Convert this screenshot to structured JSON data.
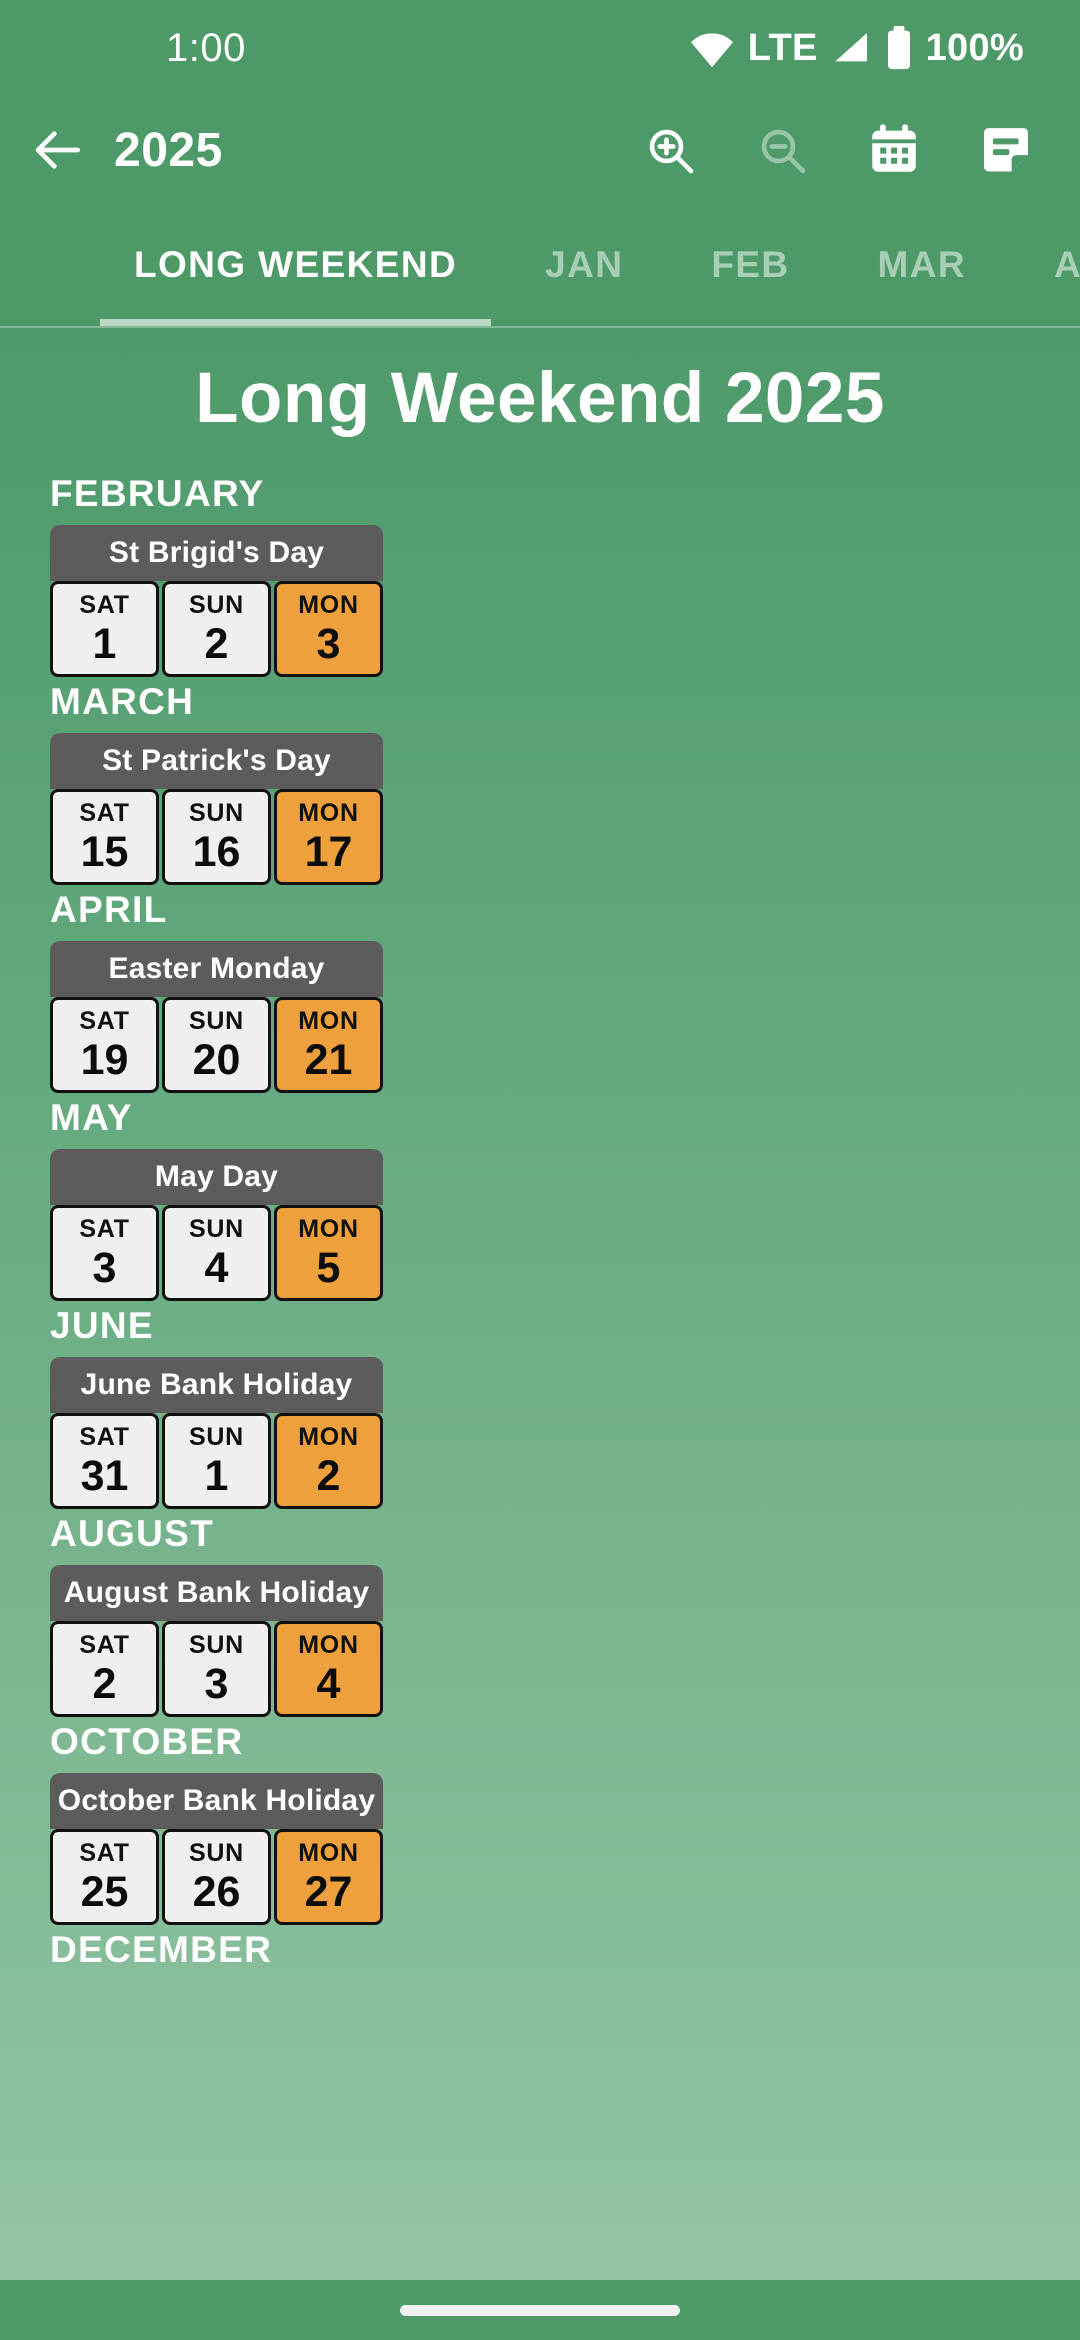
{
  "status_bar": {
    "clock": "1:00",
    "network_label": "LTE",
    "battery_label": "100%",
    "wifi_icon": "wifi-icon",
    "signal_icon": "signal-icon",
    "battery_icon": "battery-icon"
  },
  "app_bar": {
    "back_icon": "back-arrow-icon",
    "title": "2025",
    "actions": [
      {
        "icon": "zoom-in-icon",
        "label": "Zoom in",
        "disabled": false
      },
      {
        "icon": "zoom-out-icon",
        "label": "Zoom out",
        "disabled": true
      },
      {
        "icon": "calendar-icon",
        "label": "Calendar",
        "disabled": false
      },
      {
        "icon": "note-icon",
        "label": "Notes",
        "disabled": false
      }
    ]
  },
  "tabs": [
    {
      "label": "LONG WEEKEND",
      "active": true
    },
    {
      "label": "JAN",
      "active": false
    },
    {
      "label": "FEB",
      "active": false
    },
    {
      "label": "MAR",
      "active": false
    },
    {
      "label": "APR",
      "active": false
    }
  ],
  "page": {
    "title": "Long Weekend 2025"
  },
  "colors": {
    "app_bar_green": "#4d9a68",
    "card_header_grey": "#5c5c5c",
    "day_cell_white": "#efefef",
    "holiday_orange": "#eda03c",
    "cell_border": "#111111",
    "text_white": "#ffffff"
  },
  "months": [
    {
      "month": "FEBRUARY",
      "holiday": "St Brigid's Day",
      "days": [
        {
          "dow": "SAT",
          "num": "1",
          "holiday": false
        },
        {
          "dow": "SUN",
          "num": "2",
          "holiday": false
        },
        {
          "dow": "MON",
          "num": "3",
          "holiday": true
        }
      ]
    },
    {
      "month": "MARCH",
      "holiday": "St Patrick's Day",
      "days": [
        {
          "dow": "SAT",
          "num": "15",
          "holiday": false
        },
        {
          "dow": "SUN",
          "num": "16",
          "holiday": false
        },
        {
          "dow": "MON",
          "num": "17",
          "holiday": true
        }
      ]
    },
    {
      "month": "APRIL",
      "holiday": "Easter Monday",
      "days": [
        {
          "dow": "SAT",
          "num": "19",
          "holiday": false
        },
        {
          "dow": "SUN",
          "num": "20",
          "holiday": false
        },
        {
          "dow": "MON",
          "num": "21",
          "holiday": true
        }
      ]
    },
    {
      "month": "MAY",
      "holiday": "May Day",
      "days": [
        {
          "dow": "SAT",
          "num": "3",
          "holiday": false
        },
        {
          "dow": "SUN",
          "num": "4",
          "holiday": false
        },
        {
          "dow": "MON",
          "num": "5",
          "holiday": true
        }
      ]
    },
    {
      "month": "JUNE",
      "holiday": "June Bank Holiday",
      "days": [
        {
          "dow": "SAT",
          "num": "31",
          "holiday": false
        },
        {
          "dow": "SUN",
          "num": "1",
          "holiday": false
        },
        {
          "dow": "MON",
          "num": "2",
          "holiday": true
        }
      ]
    },
    {
      "month": "AUGUST",
      "holiday": "August Bank Holiday",
      "days": [
        {
          "dow": "SAT",
          "num": "2",
          "holiday": false
        },
        {
          "dow": "SUN",
          "num": "3",
          "holiday": false
        },
        {
          "dow": "MON",
          "num": "4",
          "holiday": true
        }
      ]
    },
    {
      "month": "OCTOBER",
      "holiday": "October Bank Holiday",
      "days": [
        {
          "dow": "SAT",
          "num": "25",
          "holiday": false
        },
        {
          "dow": "SUN",
          "num": "26",
          "holiday": false
        },
        {
          "dow": "MON",
          "num": "27",
          "holiday": true
        }
      ]
    },
    {
      "month": "DECEMBER",
      "holiday": "",
      "days": []
    }
  ],
  "nav_bar": {
    "home_pill": "home-gesture-pill"
  }
}
